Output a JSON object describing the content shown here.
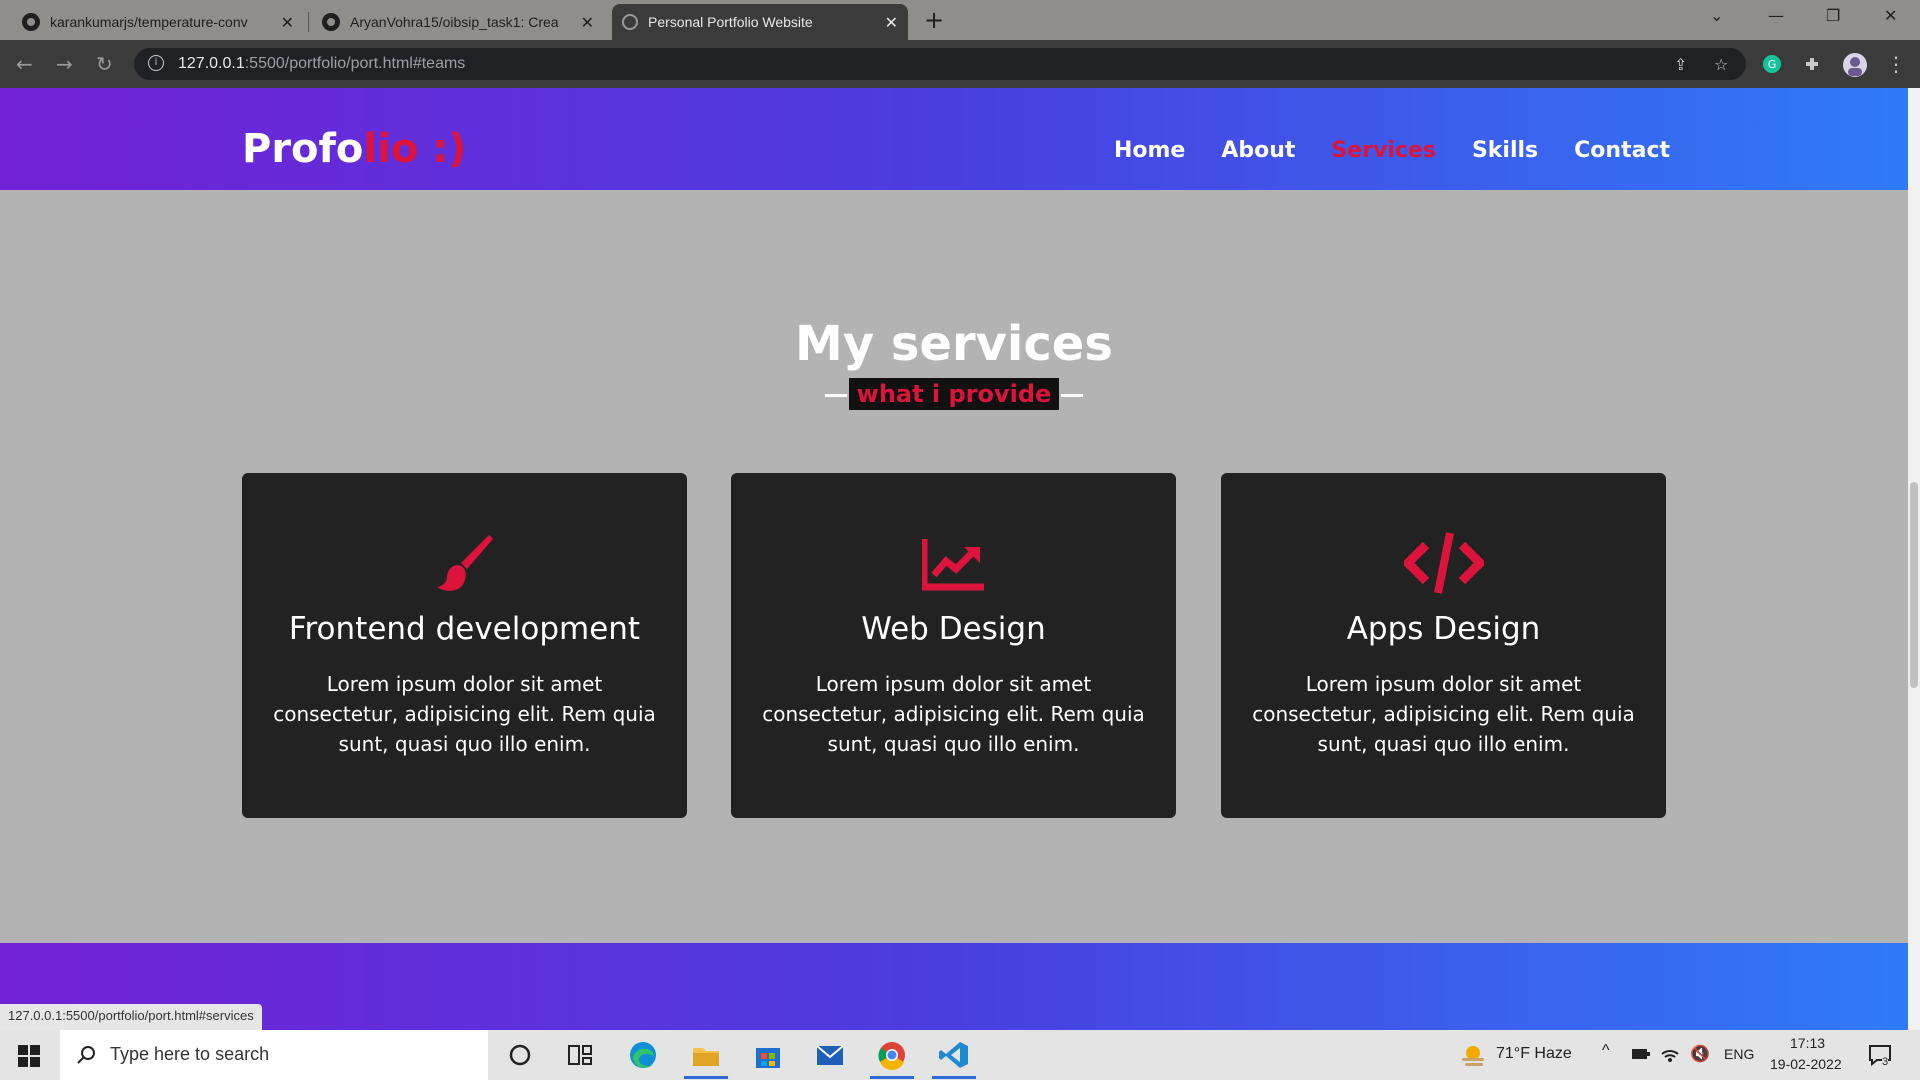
{
  "browser": {
    "tabs": [
      {
        "title": "karankumarjs/temperature-conv",
        "active": false
      },
      {
        "title": "AryanVohra15/oibsip_task1: Crea",
        "active": false
      },
      {
        "title": "Personal Portfolio Website",
        "active": true
      }
    ],
    "url_host": "127.0.0.1",
    "url_path": ":5500/portfolio/port.html#teams",
    "status_link": "127.0.0.1:5500/portfolio/port.html#services"
  },
  "page": {
    "logo_main": "Profo",
    "logo_accent": "lio :)",
    "nav": [
      "Home",
      "About",
      "Services",
      "Skills",
      "Contact"
    ],
    "nav_active": "Services",
    "section_title": "My services",
    "section_subtitle": "what i provide",
    "cards": [
      {
        "icon": "paint-brush-icon",
        "title": "Frontend development",
        "desc": "Lorem ipsum dolor sit amet consectetur, adipisicing elit. Rem quia sunt, quasi quo illo enim."
      },
      {
        "icon": "chart-line-icon",
        "title": "Web Design",
        "desc": "Lorem ipsum dolor sit amet consectetur, adipisicing elit. Rem quia sunt, quasi quo illo enim."
      },
      {
        "icon": "code-icon",
        "title": "Apps Design",
        "desc": "Lorem ipsum dolor sit amet consectetur, adipisicing elit. Rem quia sunt, quasi quo illo enim."
      }
    ],
    "colors": {
      "accent": "#dc143c",
      "card_bg": "#222222",
      "page_bg": "#b3b3b3"
    }
  },
  "taskbar": {
    "search_placeholder": "Type here to search",
    "weather": "71°F  Haze",
    "language": "ENG",
    "time": "17:13",
    "date": "19-02-2022",
    "notification_count": "3"
  }
}
